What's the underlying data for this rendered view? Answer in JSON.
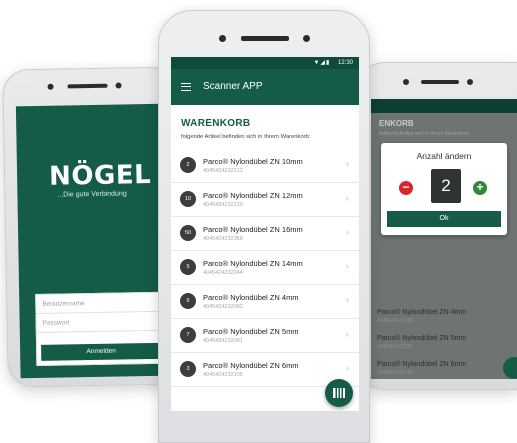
{
  "left_screen": {
    "logo": "NÖGEL",
    "tagline": "...Die gute Verbindung",
    "username_placeholder": "Benutzername",
    "password_placeholder": "Passwort",
    "login_button": "Anmelden"
  },
  "center_screen": {
    "status_time": "12:30",
    "app_title": "Scanner APP",
    "cart_title": "WARENKORB",
    "cart_subtitle": "folgende Artikel befinden sich in Ihrem Warenkorb:",
    "items": [
      {
        "qty": "2",
        "name": "Parco® Nylondübel ZN 10mm",
        "code": "4045424232213"
      },
      {
        "qty": "10",
        "name": "Parco® Nylondübel ZN 12mm",
        "code": "4045424232220"
      },
      {
        "qty": "50",
        "name": "Parco® Nylondübel ZN 16mm",
        "code": "4045424232368"
      },
      {
        "qty": "5",
        "name": "Parco® Nylondübel ZN 14mm",
        "code": "4045424232244"
      },
      {
        "qty": "6",
        "name": "Parco® Nylondübel ZN 4mm",
        "code": "4045424232082"
      },
      {
        "qty": "7",
        "name": "Parco® Nylondübel ZN 5mm",
        "code": "4045424232091"
      },
      {
        "qty": "3",
        "name": "Parco® Nylondübel ZN 6mm",
        "code": "4045424232105"
      }
    ]
  },
  "right_screen": {
    "title_fragment": "ENKORB",
    "subtitle_fragment": "Artikel befinden sich in Ihrem Warenkorb:",
    "dialog_title": "Anzahl ändern",
    "quantity": "2",
    "ok_button": "Ok",
    "items": [
      {
        "name": "Parco® Nylondübel ZN 4mm",
        "code": "4045424232082"
      },
      {
        "name": "Parco® Nylondübel ZN 5mm",
        "code": "4045424232091"
      },
      {
        "name": "Parco® Nylondübel ZN 6mm",
        "code": "4045424232105"
      }
    ]
  }
}
